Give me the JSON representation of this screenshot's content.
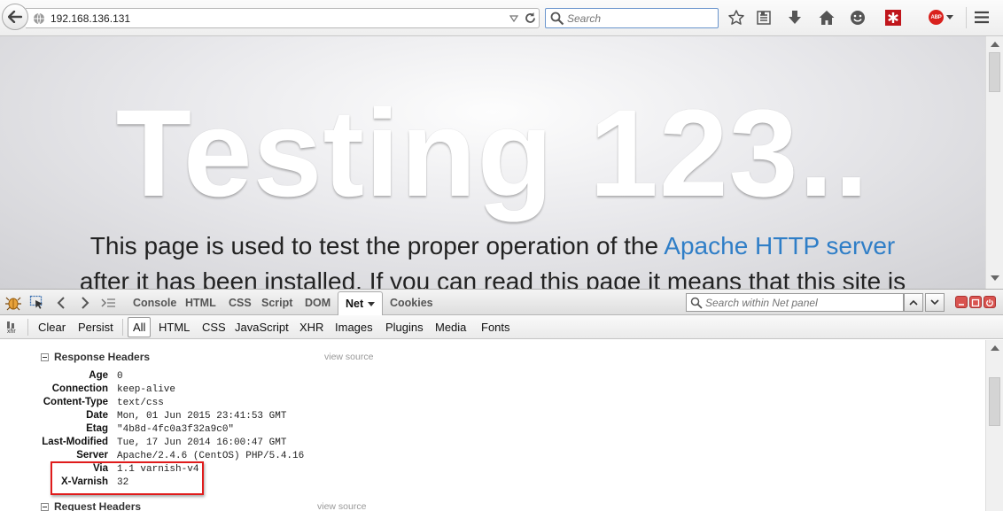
{
  "browser": {
    "url": "192.168.136.131",
    "search_placeholder": "Search",
    "abp_label": "ABP"
  },
  "page": {
    "title": "Testing 123..",
    "line1_prefix": "This page is used to test the proper operation of the ",
    "line1_link": "Apache HTTP server",
    "line2": "after it has been installed. If you can read this page it means that this site is"
  },
  "firebug": {
    "tabs": [
      "Console",
      "HTML",
      "CSS",
      "Script",
      "DOM",
      "Net",
      "Cookies"
    ],
    "active_tab": "Net",
    "search_placeholder": "Search within Net panel",
    "xhr_label": "xhr",
    "net_buttons": [
      "Clear",
      "Persist"
    ],
    "net_filters": [
      "All",
      "HTML",
      "CSS",
      "JavaScript",
      "XHR",
      "Images",
      "Plugins",
      "Media",
      "Fonts"
    ],
    "active_filter": "All",
    "response_headers_title": "Response Headers",
    "request_headers_title": "Request Headers",
    "view_source": "view source",
    "response_headers": [
      {
        "name": "Age",
        "value": "0"
      },
      {
        "name": "Connection",
        "value": "keep-alive"
      },
      {
        "name": "Content-Type",
        "value": "text/css"
      },
      {
        "name": "Date",
        "value": "Mon, 01 Jun 2015 23:41:53 GMT"
      },
      {
        "name": "Etag",
        "value": "\"4b8d-4fc0a3f32a9c0\""
      },
      {
        "name": "Last-Modified",
        "value": "Tue, 17 Jun 2014 16:00:47 GMT"
      },
      {
        "name": "Server",
        "value": "Apache/2.4.6 (CentOS) PHP/5.4.16"
      },
      {
        "name": "Via",
        "value": "1.1 varnish-v4"
      },
      {
        "name": "X-Varnish",
        "value": "32"
      }
    ]
  },
  "colors": {
    "link": "#2f7ec7",
    "highlight": "#e01b1b",
    "abp": "#d9211d"
  }
}
